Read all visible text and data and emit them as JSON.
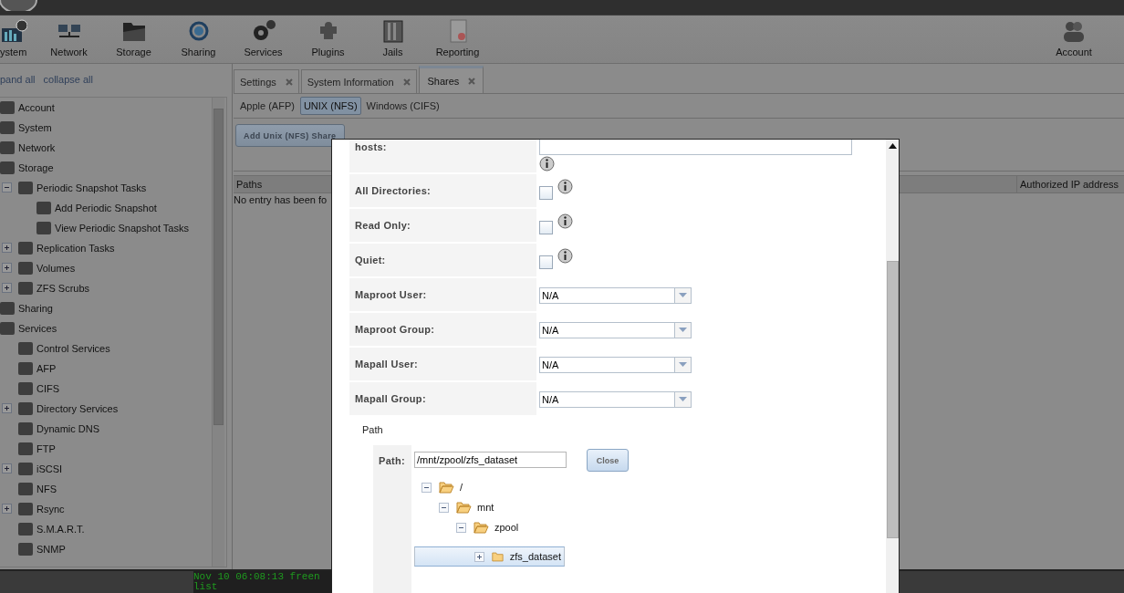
{
  "toolbar": {
    "items": [
      {
        "label": "ystem"
      },
      {
        "label": "Network"
      },
      {
        "label": "Storage"
      },
      {
        "label": "Sharing"
      },
      {
        "label": "Services"
      },
      {
        "label": "Plugins"
      },
      {
        "label": "Jails"
      },
      {
        "label": "Reporting"
      }
    ],
    "right_items": [
      {
        "label": "Account"
      }
    ]
  },
  "sidebar": {
    "links": [
      "pand all",
      "collapse all"
    ],
    "tree": [
      {
        "label": "Account"
      },
      {
        "label": "System"
      },
      {
        "label": "Network"
      },
      {
        "label": "Storage",
        "children": [
          {
            "label": "Periodic Snapshot Tasks",
            "expanded": true,
            "children": [
              {
                "label": "Add Periodic Snapshot"
              },
              {
                "label": "View Periodic Snapshot Tasks"
              }
            ]
          },
          {
            "label": "Replication Tasks",
            "expanded": false
          },
          {
            "label": "Volumes",
            "expanded": false
          },
          {
            "label": "ZFS Scrubs",
            "expanded": false
          }
        ]
      },
      {
        "label": "Sharing"
      },
      {
        "label": "Services",
        "children": [
          {
            "label": "Control Services"
          },
          {
            "label": "AFP"
          },
          {
            "label": "CIFS"
          },
          {
            "label": "Directory Services",
            "expanded": false
          },
          {
            "label": "Dynamic DNS"
          },
          {
            "label": "FTP"
          },
          {
            "label": "iSCSI",
            "expanded": false
          },
          {
            "label": "NFS"
          },
          {
            "label": "Rsync",
            "expanded": false
          },
          {
            "label": "S.M.A.R.T."
          },
          {
            "label": "SNMP"
          }
        ]
      }
    ]
  },
  "tabs": [
    {
      "label": "Settings",
      "selected": false
    },
    {
      "label": "System Information",
      "selected": false
    },
    {
      "label": "Shares",
      "selected": true
    }
  ],
  "subtabs": [
    {
      "label": "Apple (AFP)",
      "selected": false
    },
    {
      "label": "UNIX (NFS)",
      "selected": true
    },
    {
      "label": "Windows (CIFS)",
      "selected": false
    }
  ],
  "add_button": "Add Unix (NFS) Share",
  "table": {
    "columns": [
      "Paths",
      "Authorized IP address"
    ],
    "empty_text": "No entry has been fo"
  },
  "console": [
    "Nov 10 06:08:13 freen",
    "list"
  ],
  "dialog": {
    "rows": [
      {
        "kind": "textarea",
        "label": "hosts:"
      },
      {
        "kind": "checkbox",
        "label": "All Directories:",
        "checked": false
      },
      {
        "kind": "checkbox",
        "label": "Read Only:",
        "checked": false
      },
      {
        "kind": "checkbox",
        "label": "Quiet:",
        "checked": false
      },
      {
        "kind": "select",
        "label": "Maproot User:",
        "value": "N/A"
      },
      {
        "kind": "select",
        "label": "Maproot Group:",
        "value": "N/A"
      },
      {
        "kind": "select",
        "label": "Mapall User:",
        "value": "N/A"
      },
      {
        "kind": "select",
        "label": "Mapall Group:",
        "value": "N/A"
      }
    ],
    "path_section": {
      "legend": "Path",
      "label": "Path:",
      "value": "/mnt/zpool/zfs_dataset",
      "close_button": "Close",
      "tree": [
        {
          "name": "/",
          "expanded": true,
          "selected": false,
          "children": [
            {
              "name": "mnt",
              "expanded": true,
              "selected": false,
              "children": [
                {
                  "name": "zpool",
                  "expanded": true,
                  "selected": false,
                  "children": [
                    {
                      "name": "zfs_dataset",
                      "expanded": false,
                      "selected": true
                    }
                  ]
                }
              ]
            }
          ]
        }
      ]
    }
  }
}
